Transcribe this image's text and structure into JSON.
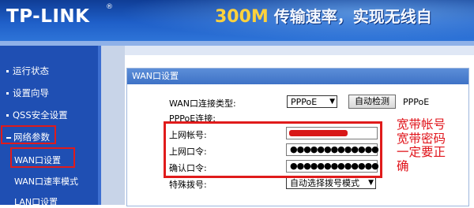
{
  "header": {
    "brand": "TP-LINK",
    "registered_mark": "®",
    "slogan_number": "300M",
    "slogan_text": "传输速率，实现无线自"
  },
  "sidebar": {
    "items": [
      {
        "label": "运行状态"
      },
      {
        "label": "设置向导"
      },
      {
        "label": "QSS安全设置"
      },
      {
        "label": "网络参数"
      }
    ],
    "subitems": [
      {
        "label": "WAN口设置"
      },
      {
        "label": "WAN口速率模式"
      },
      {
        "label": "LAN口设置"
      }
    ]
  },
  "panel": {
    "title": "WAN口设置",
    "wan_type_label": "WAN口连接类型:",
    "wan_type_value": "PPPoE",
    "detect_button": "自动检测",
    "wan_type_note": "PPPoE",
    "section_label": "PPPoE连接:",
    "account_label": "上网帐号:",
    "password_label": "上网口令:",
    "password_value": "●●●●●●●●●●●●●",
    "confirm_label": "确认口令:",
    "confirm_value": "●●●●●●●●●●●●●",
    "dial_label": "特殊拨号:",
    "dial_value": "自动选择拨号模式"
  },
  "annotation": {
    "lines": [
      "宽带帐号",
      "宽带密码",
      "一定要正",
      "确"
    ]
  },
  "colors": {
    "header_blue": "#1f5fc8",
    "sidebar_blue": "#1f4fb3",
    "annotation_red": "#e0141b",
    "slogan_number": "#ffd23c"
  }
}
